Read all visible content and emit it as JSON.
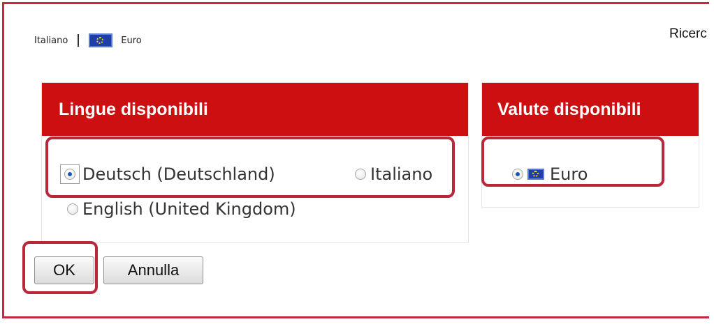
{
  "header": {
    "language": "Italiano",
    "currency": "Euro",
    "search_label": "Ricerc"
  },
  "languages_panel": {
    "title": "Lingue disponibili",
    "options": [
      {
        "label": "Deutsch (Deutschland)",
        "selected": true
      },
      {
        "label": "Italiano",
        "selected": false
      },
      {
        "label": "English (United Kingdom)",
        "selected": false
      }
    ]
  },
  "currencies_panel": {
    "title": "Valute disponibili",
    "options": [
      {
        "label": "Euro",
        "selected": true,
        "icon": "eu-flag-icon"
      }
    ]
  },
  "buttons": {
    "ok": "OK",
    "cancel": "Annulla"
  },
  "colors": {
    "panel_header": "#cc1012",
    "highlight": "#b8283a",
    "radio_selected": "#1a56b3"
  }
}
